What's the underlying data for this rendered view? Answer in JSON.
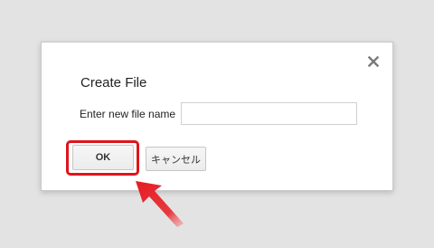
{
  "dialog": {
    "title": "Create File",
    "close_symbol": "×",
    "close_icon": "close-icon",
    "field_label": "Enter new file name",
    "input_value": "",
    "ok_label": "OK",
    "cancel_label": "キャンセル"
  },
  "annotation": {
    "highlight_color": "#e0141b",
    "arrow_icon": "pointer-arrow-icon"
  }
}
